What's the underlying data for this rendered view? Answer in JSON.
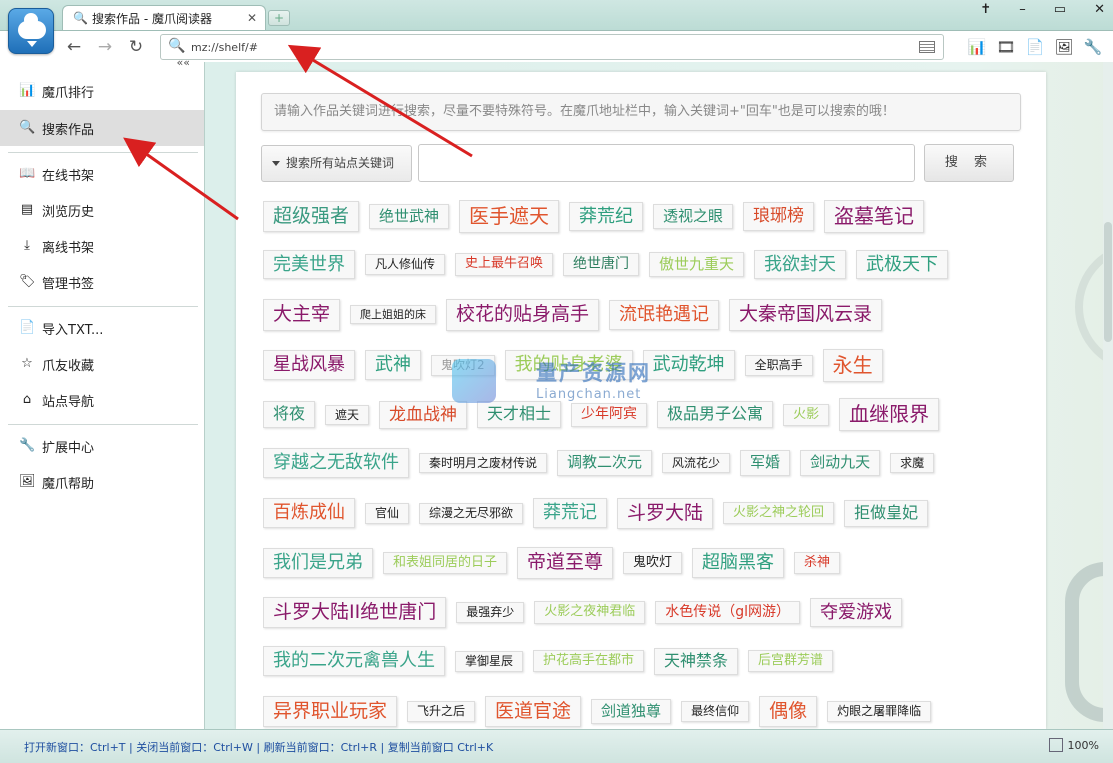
{
  "tab": {
    "title": "搜索作品 - 魔爪阅读器",
    "icon": "search-icon"
  },
  "address": {
    "url": "mz://shelf/#"
  },
  "sidebar": {
    "collapse_label": "««",
    "items": [
      {
        "label": "魔爪排行",
        "icon": "bar-chart-icon"
      },
      {
        "label": "搜索作品",
        "icon": "search-icon",
        "active": true
      },
      {
        "label": "在线书架",
        "icon": "book-icon"
      },
      {
        "label": "浏览历史",
        "icon": "history-icon"
      },
      {
        "label": "离线书架",
        "icon": "download-icon"
      },
      {
        "label": "管理书签",
        "icon": "bookmark-icon"
      },
      {
        "label": "导入TXT...",
        "icon": "document-icon"
      },
      {
        "label": "爪友收藏",
        "icon": "star-icon"
      },
      {
        "label": "站点导航",
        "icon": "home-icon"
      },
      {
        "label": "扩展中心",
        "icon": "wrench-icon"
      },
      {
        "label": "魔爪帮助",
        "icon": "image-icon"
      }
    ]
  },
  "search": {
    "hint": "请输入作品关键词进行搜索，尽量不要特殊符号。在魔爪地址栏中，输入关键词+\"回车\"也是可以搜索的哦！",
    "scope_label": "搜索所有站点关键词",
    "input_value": "",
    "button_label": "搜 索"
  },
  "tag_rows": [
    [
      {
        "t": "超级强者",
        "s": 19,
        "c": "#3a9a80"
      },
      {
        "t": "绝世武神",
        "s": 15,
        "c": "#2f8f70"
      },
      {
        "t": "医手遮天",
        "s": 20,
        "c": "#e0552e"
      },
      {
        "t": "莽荒纪",
        "s": 18,
        "c": "#2f9f7f"
      },
      {
        "t": "透视之眼",
        "s": 15,
        "c": "#2f8f70"
      },
      {
        "t": "琅琊榜",
        "s": 17,
        "c": "#d84b2a"
      },
      {
        "t": "盗墓笔记",
        "s": 20,
        "c": "#8a1a6a"
      }
    ],
    [
      {
        "t": "完美世界",
        "s": 18,
        "c": "#3aa48a"
      },
      {
        "t": "凡人修仙传",
        "s": 12,
        "c": "#222222"
      },
      {
        "t": "史上最牛召唤",
        "s": 13,
        "c": "#d83a2a"
      },
      {
        "t": "绝世唐门",
        "s": 14,
        "c": "#2f7f60"
      },
      {
        "t": "傲世九重天",
        "s": 15,
        "c": "#9ccc5a"
      },
      {
        "t": "我欲封天",
        "s": 18,
        "c": "#3aa48a"
      },
      {
        "t": "武极天下",
        "s": 18,
        "c": "#2f9f7f"
      }
    ],
    [
      {
        "t": "大主宰",
        "s": 19,
        "c": "#8a1a6a"
      },
      {
        "t": "爬上姐姐的床",
        "s": 11,
        "c": "#222222"
      },
      {
        "t": "校花的贴身高手",
        "s": 19,
        "c": "#8a1a6a"
      },
      {
        "t": "流氓艳遇记",
        "s": 18,
        "c": "#e0552e"
      },
      {
        "t": "大秦帝国风云录",
        "s": 19,
        "c": "#8a1a6a"
      }
    ],
    [
      {
        "t": "星战风暴",
        "s": 18,
        "c": "#8a1a6a"
      },
      {
        "t": "武神",
        "s": 18,
        "c": "#2f9f7f"
      },
      {
        "t": "鬼吹灯2",
        "s": 12,
        "c": "#999999"
      },
      {
        "t": "我的贴身老婆",
        "s": 18,
        "c": "#9ccc5a"
      },
      {
        "t": "武动乾坤",
        "s": 18,
        "c": "#2f9f7f"
      },
      {
        "t": "全职高手",
        "s": 12,
        "c": "#222222"
      },
      {
        "t": "永生",
        "s": 20,
        "c": "#e0552e"
      }
    ],
    [
      {
        "t": "将夜",
        "s": 16,
        "c": "#2f8f70"
      },
      {
        "t": "遮天",
        "s": 12,
        "c": "#222222"
      },
      {
        "t": "龙血战神",
        "s": 17,
        "c": "#d84b2a"
      },
      {
        "t": "天才相士",
        "s": 16,
        "c": "#2f8f70"
      },
      {
        "t": "少年阿宾",
        "s": 14,
        "c": "#d83a2a"
      },
      {
        "t": "极品男子公寓",
        "s": 16,
        "c": "#2f8f70"
      },
      {
        "t": "火影",
        "s": 13,
        "c": "#9ccc5a"
      },
      {
        "t": "血继限界",
        "s": 20,
        "c": "#8a1a6a"
      }
    ],
    [
      {
        "t": "穿越之无敌软件",
        "s": 18,
        "c": "#3aa48a"
      },
      {
        "t": "秦时明月之废材传说",
        "s": 12,
        "c": "#222222"
      },
      {
        "t": "调教二次元",
        "s": 15,
        "c": "#2f8f70"
      },
      {
        "t": "风流花少",
        "s": 12,
        "c": "#222222"
      },
      {
        "t": "军婚",
        "s": 15,
        "c": "#2f8f70"
      },
      {
        "t": "剑动九天",
        "s": 15,
        "c": "#2f8f70"
      },
      {
        "t": "求魔",
        "s": 12,
        "c": "#222222"
      }
    ],
    [
      {
        "t": "百炼成仙",
        "s": 18,
        "c": "#e0552e"
      },
      {
        "t": "官仙",
        "s": 12,
        "c": "#222222"
      },
      {
        "t": "综漫之无尽邪欲",
        "s": 12,
        "c": "#222222"
      },
      {
        "t": "莽荒记",
        "s": 18,
        "c": "#3aa48a"
      },
      {
        "t": "斗罗大陆",
        "s": 19,
        "c": "#8a1a6a"
      },
      {
        "t": "火影之神之轮回",
        "s": 13,
        "c": "#9ccc5a"
      },
      {
        "t": "拒做皇妃",
        "s": 16,
        "c": "#2f8f70"
      }
    ],
    [
      {
        "t": "我们是兄弟",
        "s": 18,
        "c": "#3aa48a"
      },
      {
        "t": "和表姐同居的日子",
        "s": 13,
        "c": "#9ccc5a"
      },
      {
        "t": "帝道至尊",
        "s": 19,
        "c": "#8a1a6a"
      },
      {
        "t": "鬼吹灯",
        "s": 13,
        "c": "#222222"
      },
      {
        "t": "超脑黑客",
        "s": 18,
        "c": "#2f9f7f"
      },
      {
        "t": "杀神",
        "s": 13,
        "c": "#d83a2a"
      }
    ],
    [
      {
        "t": "斗罗大陆II绝世唐门",
        "s": 19,
        "c": "#8a1a6a"
      },
      {
        "t": "最强弃少",
        "s": 12,
        "c": "#222222"
      },
      {
        "t": "火影之夜神君临",
        "s": 13,
        "c": "#9ccc5a"
      },
      {
        "t": "水色传说（gl网游）",
        "s": 14,
        "c": "#d83a2a"
      },
      {
        "t": "夺爱游戏",
        "s": 18,
        "c": "#8a1a6a"
      }
    ],
    [
      {
        "t": "我的二次元禽兽人生",
        "s": 18,
        "c": "#3aa48a"
      },
      {
        "t": "掌御星辰",
        "s": 12,
        "c": "#222222"
      },
      {
        "t": "护花高手在都市",
        "s": 13,
        "c": "#9ccc5a"
      },
      {
        "t": "天神禁条",
        "s": 16,
        "c": "#2f8f70"
      },
      {
        "t": "后宫群芳谱",
        "s": 13,
        "c": "#9ccc5a"
      }
    ],
    [
      {
        "t": "异界职业玩家",
        "s": 19,
        "c": "#e0552e"
      },
      {
        "t": "飞升之后",
        "s": 12,
        "c": "#222222"
      },
      {
        "t": "医道官途",
        "s": 19,
        "c": "#e0552e"
      },
      {
        "t": "剑道独尊",
        "s": 15,
        "c": "#2f8f70"
      },
      {
        "t": "最终信仰",
        "s": 12,
        "c": "#222222"
      },
      {
        "t": "偶像",
        "s": 19,
        "c": "#e0552e"
      },
      {
        "t": "灼眼之屠罪降临",
        "s": 12,
        "c": "#222222"
      }
    ]
  ],
  "watermark": {
    "title": "量产资源网",
    "domain": "Liangchan.net"
  },
  "status": {
    "shortcuts": "打开新窗口：Ctrl+T | 关闭当前窗口：Ctrl+W | 刷新当前窗口：Ctrl+R | 复制当前窗口 Ctrl+K",
    "zoom": "100%"
  },
  "colors": {
    "annotation_arrow": "#d92020",
    "accent": "#1f6fb8"
  }
}
